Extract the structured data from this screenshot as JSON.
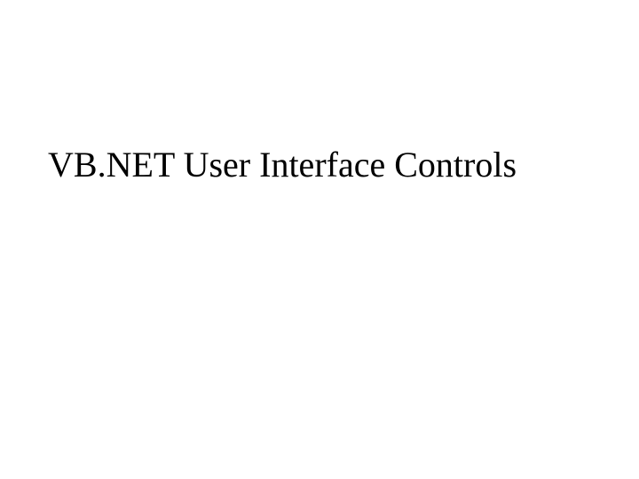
{
  "slide": {
    "title": "VB.NET User Interface Controls"
  }
}
